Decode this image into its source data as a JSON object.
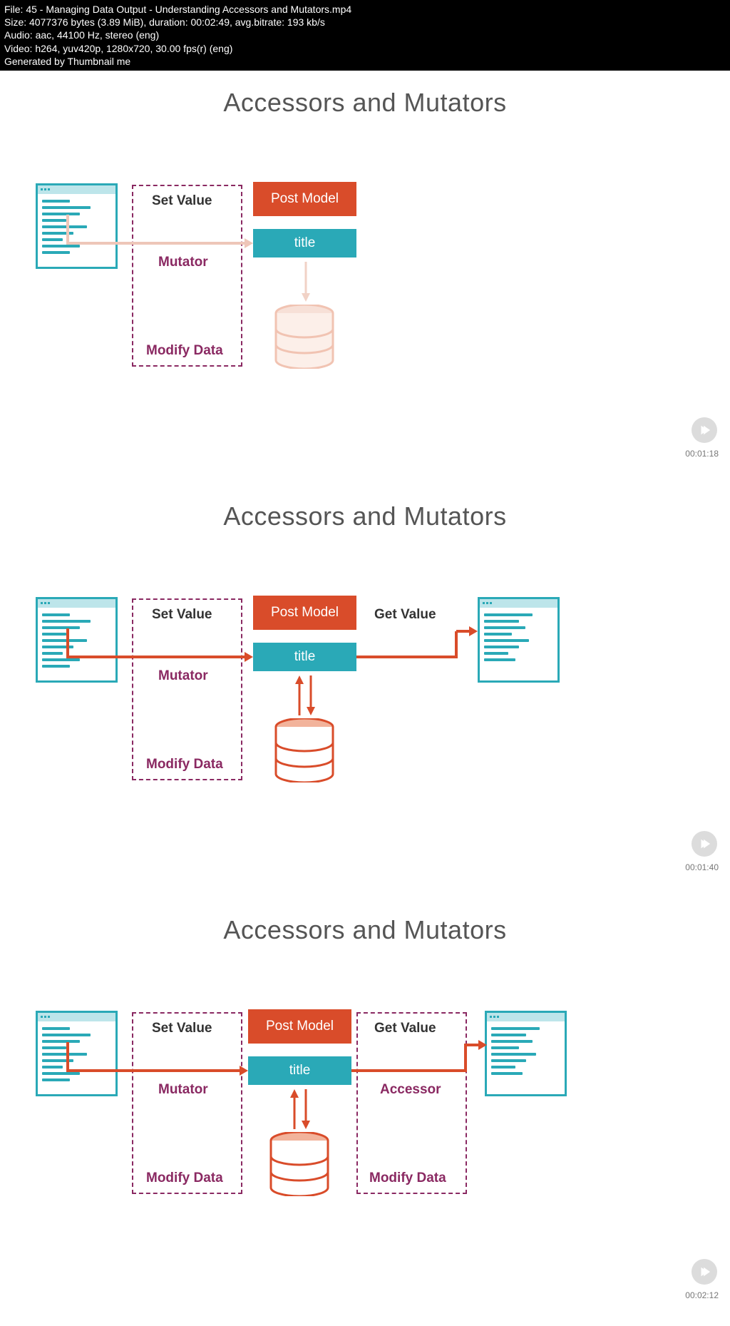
{
  "header": {
    "file": "File: 45 - Managing Data Output - Understanding Accessors and Mutators.mp4",
    "size": "Size: 4077376 bytes (3.89 MiB), duration: 00:02:49, avg.bitrate: 193 kb/s",
    "audio": "Audio: aac, 44100 Hz, stereo (eng)",
    "video": "Video: h264, yuv420p, 1280x720, 30.00 fps(r) (eng)",
    "generated": "Generated by Thumbnail me"
  },
  "slides": {
    "title": "Accessors and Mutators",
    "set_value": "Set Value",
    "get_value": "Get Value",
    "mutator": "Mutator",
    "accessor": "Accessor",
    "modify_data": "Modify Data",
    "post_model": "Post Model",
    "title_attr": "title"
  },
  "timestamps": {
    "s1": "00:01:18",
    "s2": "00:01:40",
    "s3": "00:02:12"
  },
  "colors": {
    "orange": "#d94c2a",
    "teal": "#2aa9b7",
    "maroon": "#8a2962"
  }
}
